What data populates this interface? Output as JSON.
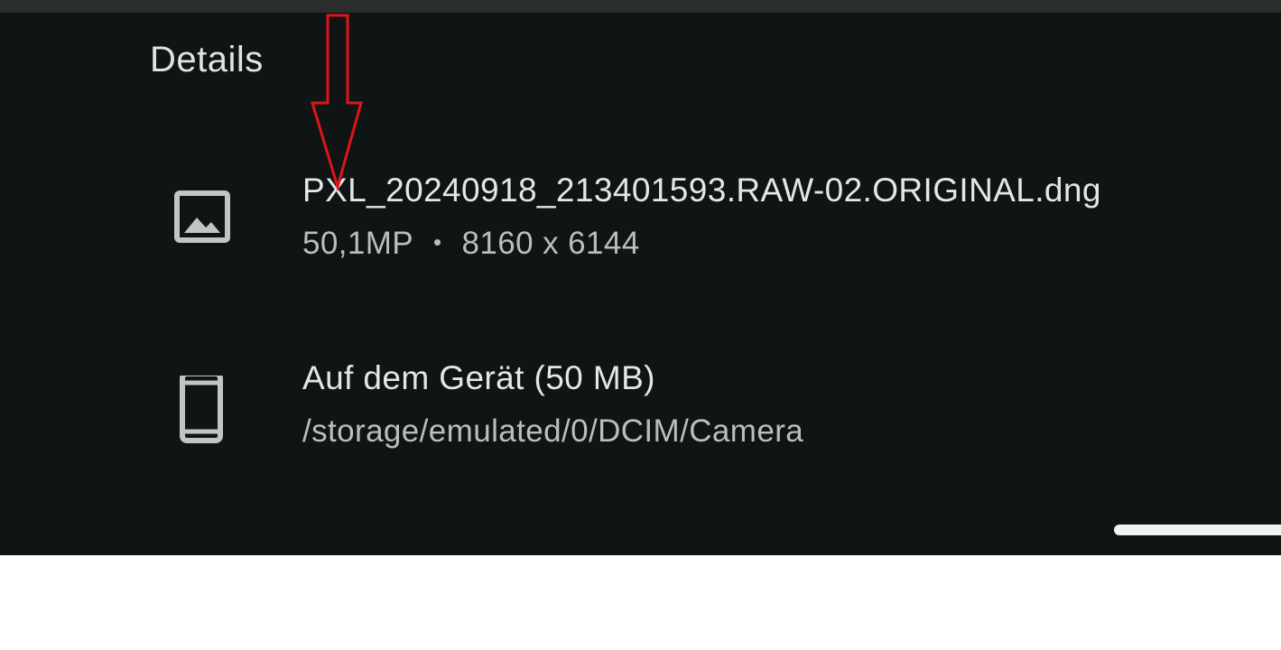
{
  "screen": {
    "title": "Details",
    "file": {
      "icon": "image-icon",
      "name": "PXL_20240918_213401593.RAW-02.ORIGINAL.dng",
      "megapixels": "50,1MP",
      "separator": "•",
      "resolution": "8160 x 6144"
    },
    "storage": {
      "icon": "phone-icon",
      "location": "Auf dem Gerät (50 MB)",
      "path": "/storage/emulated/0/DCIM/Camera"
    }
  },
  "colors": {
    "background": "#0f1514",
    "annotation_arrow": "#e0141b"
  }
}
